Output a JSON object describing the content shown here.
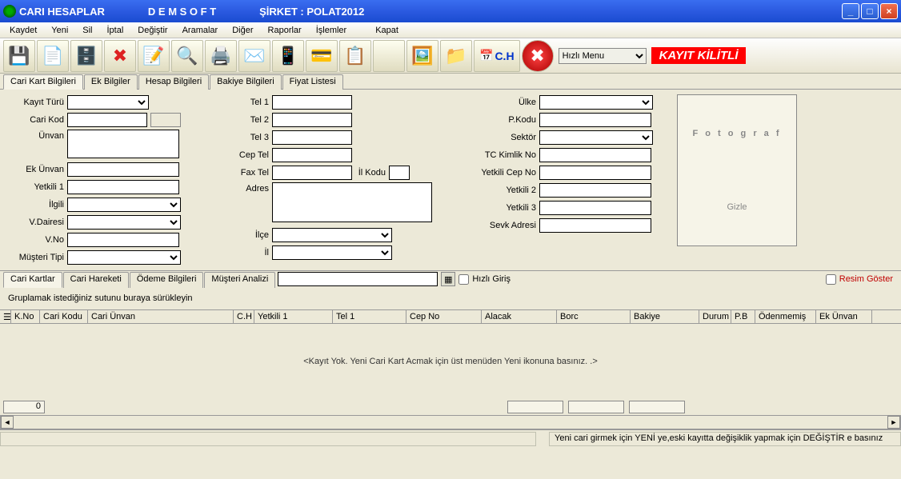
{
  "title": {
    "app": "CARI HESAPLAR",
    "brand": "D E M S O F T",
    "company_label": "ŞİRKET : POLAT2012"
  },
  "menubar": [
    "Kaydet",
    "Yeni",
    "Sil",
    "İptal",
    "Değiştir",
    "Aramalar",
    "Diğer",
    "Raporlar",
    "İşlemler",
    "Kapat"
  ],
  "toolbar": {
    "quick_menu": "Hızlı Menu",
    "locked": "KAYIT KİLİTLİ",
    "ch_label": "C.H"
  },
  "tabs_top": [
    "Cari Kart Bilgileri",
    "Ek Bilgiler",
    "Hesap Bilgileri",
    "Bakiye Bilgileri",
    "Fiyat Listesi"
  ],
  "form": {
    "col1": {
      "kayit_turu": "Kayıt Türü",
      "cari_kod": "Cari Kod",
      "unvan": "Ünvan",
      "ek_unvan": "Ek Ünvan",
      "yetkili1": "Yetkili 1",
      "ilgili": "İlgili",
      "vdairesi": "V.Dairesi",
      "vno": "V.No",
      "musteri_tipi": "Müşteri Tipi"
    },
    "col2": {
      "tel1": "Tel 1",
      "tel2": "Tel 2",
      "tel3": "Tel 3",
      "cep_tel": "Cep Tel",
      "fax_tel": "Fax Tel",
      "il_kodu": "İl Kodu",
      "adres": "Adres",
      "ilce": "İlçe",
      "il": "İl"
    },
    "col3": {
      "ulke": "Ülke",
      "pkodu": "P.Kodu",
      "sektor": "Sektör",
      "tckimlik": "TC Kimlik No",
      "yetkili_cep": "Yetkili Cep No",
      "yetkili2": "Yetkili 2",
      "yetkili3": "Yetkili 3",
      "sevk_adres": "Sevk Adresi"
    },
    "photo": {
      "label": "F o t o g r a f",
      "gizle": "Gizle"
    }
  },
  "tabs_bottom": [
    "Cari Kartlar",
    "Cari Hareketi",
    "Ödeme Bilgileri",
    "Müşteri Analizi"
  ],
  "hizli_giris": "Hızlı Giriş",
  "resim_goster": "Resim Göster",
  "group_hint": "Gruplamak istediğiniz sutunu buraya sürükleyin",
  "grid_cols": [
    "K.No",
    "Cari Kodu",
    "Cari Ünvan",
    "C.H",
    "Yetkili 1",
    "Tel 1",
    "Cep No",
    "Alacak",
    "Borc",
    "Bakiye",
    "Durum",
    "P.B",
    "Ödenmemiş",
    "Ek Ünvan"
  ],
  "grid_widths": [
    36,
    60,
    182,
    26,
    98,
    92,
    94,
    94,
    92,
    86,
    40,
    30,
    76,
    70
  ],
  "grid_empty": "<Kayıt Yok. Yeni Cari Kart Acmak için üst menüden Yeni ikonuna basınız. .>",
  "footer": {
    "kno": "0"
  },
  "status": "Yeni cari girmek için YENİ ye,eski kayıtta değişiklik yapmak için DEĞİŞTİR e basınız"
}
